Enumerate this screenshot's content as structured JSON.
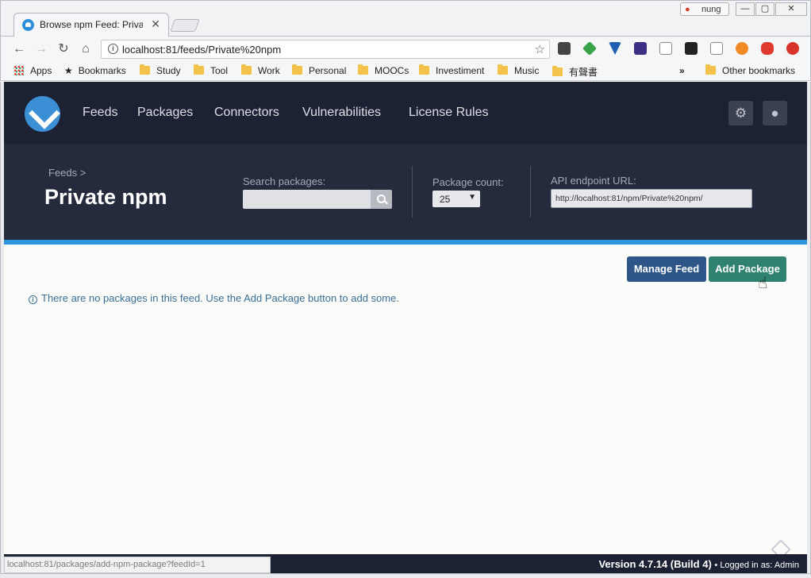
{
  "browser": {
    "tab_title": "Browse npm Feed: Private npm",
    "tab_close": "✕",
    "profile_name": "nung",
    "address": "localhost:81/feeds/Private%20npm",
    "bookmarks": [
      "Apps",
      "Bookmarks",
      "Study",
      "Tool",
      "Work",
      "Personal",
      "MOOCs",
      "Investiment",
      "Music",
      "有聲書"
    ],
    "overflow": "»",
    "other_bookmarks": "Other bookmarks",
    "status_url": "localhost:81/packages/add-npm-package?feedId=1"
  },
  "nav": {
    "items": [
      "Feeds",
      "Packages",
      "Connectors",
      "Vulnerabilities",
      "License Rules"
    ],
    "settings_icon": "gear-icon",
    "user_icon": "user-icon"
  },
  "header": {
    "breadcrumb": "Feeds >",
    "title": "Private npm",
    "search_label": "Search packages:",
    "search_placeholder": "",
    "count_label": "Package count:",
    "count_value": "25",
    "api_label": "API endpoint URL:",
    "api_url": "http://localhost:81/npm/Private%20npm/"
  },
  "actions": {
    "manage_feed": "Manage Feed",
    "add_package": "Add Package"
  },
  "content": {
    "empty_notice": "There are no packages in this feed. Use the Add Package button to add some."
  },
  "footer": {
    "version": "Version 4.7.14 (Build 4)",
    "logged_in": "• Logged in as: Admin"
  },
  "colors": {
    "nav_bg": "#1c2233",
    "header_bg": "#252b3d",
    "accent_strip": "#2b96dc",
    "manage_btn": "#2e5588",
    "add_btn": "#2f8170"
  }
}
